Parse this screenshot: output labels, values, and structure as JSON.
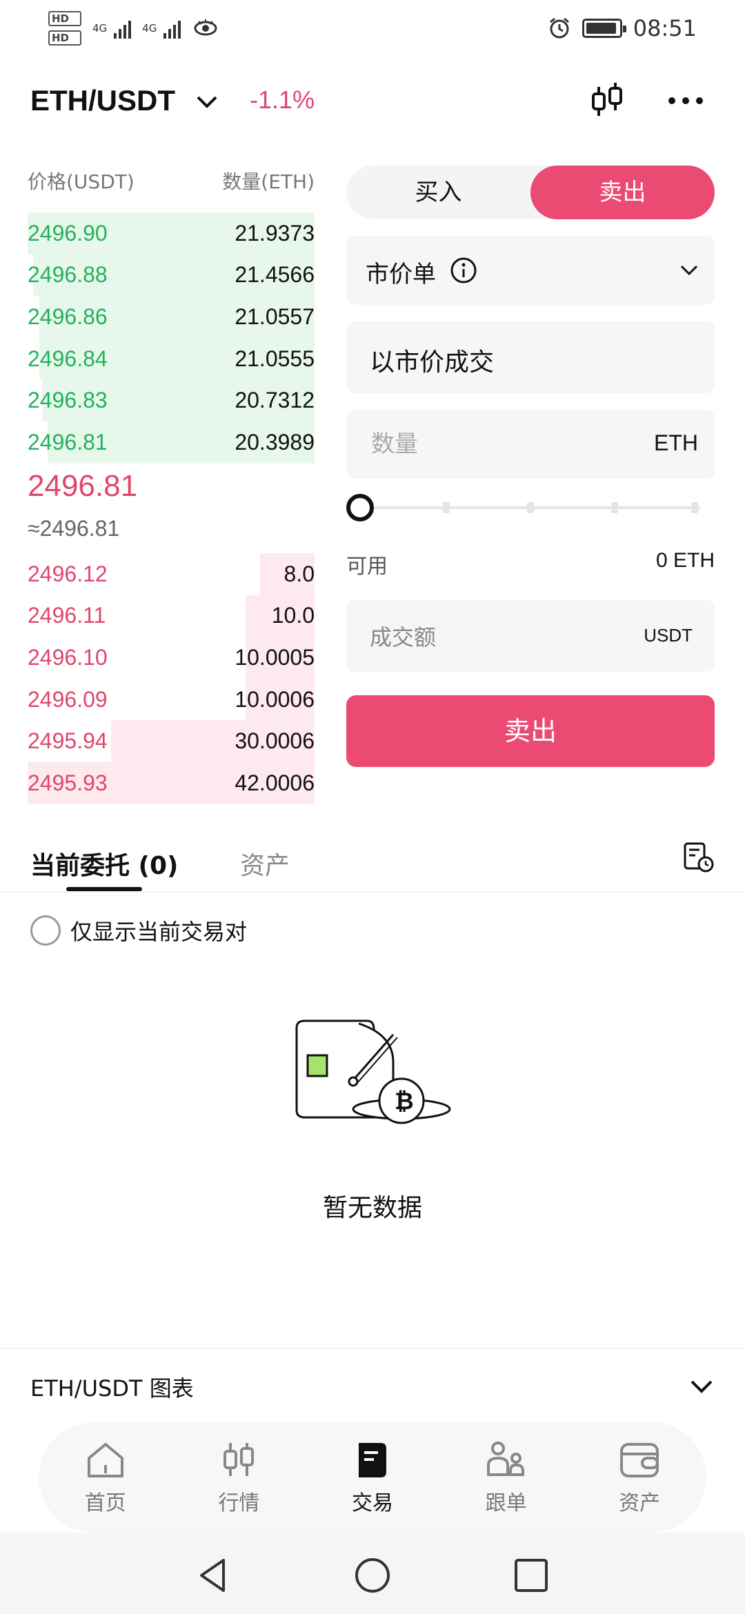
{
  "status_bar": {
    "time": "08:51",
    "network_1": "4G",
    "network_2": "4G",
    "hd1": "HD",
    "hd2": "HD"
  },
  "header": {
    "pair": "ETH/USDT",
    "change": "-1.1%"
  },
  "order_book": {
    "price_header": "价格(USDT)",
    "qty_header": "数量(ETH)",
    "asks": [
      {
        "price": "2496.90",
        "qty": "21.9373",
        "depth": 1.0
      },
      {
        "price": "2496.88",
        "qty": "21.4566",
        "depth": 0.98
      },
      {
        "price": "2496.86",
        "qty": "21.0557",
        "depth": 0.96
      },
      {
        "price": "2496.84",
        "qty": "21.0555",
        "depth": 0.96
      },
      {
        "price": "2496.83",
        "qty": "20.7312",
        "depth": 0.95
      },
      {
        "price": "2496.81",
        "qty": "20.3989",
        "depth": 0.93
      }
    ],
    "last_price": "2496.81",
    "last_price_approx": "≈2496.81",
    "bids": [
      {
        "price": "2496.12",
        "qty": "8.0",
        "depth": 0.19
      },
      {
        "price": "2496.11",
        "qty": "10.0",
        "depth": 0.24
      },
      {
        "price": "2496.10",
        "qty": "10.0005",
        "depth": 0.24
      },
      {
        "price": "2496.09",
        "qty": "10.0006",
        "depth": 0.24
      },
      {
        "price": "2495.94",
        "qty": "30.0006",
        "depth": 0.71
      },
      {
        "price": "2495.93",
        "qty": "42.0006",
        "depth": 1.0
      }
    ]
  },
  "trade": {
    "buy_label": "买入",
    "sell_label": "卖出",
    "order_type": "市价单",
    "market_text": "以市价成交",
    "qty_placeholder": "数量",
    "qty_unit": "ETH",
    "available_label": "可用",
    "available_value": "0 ETH",
    "amount_placeholder": "成交额",
    "amount_unit": "USDT",
    "submit_label": "卖出",
    "slider_value": 0
  },
  "tabs": {
    "orders": "当前委托 (0)",
    "assets": "资产"
  },
  "filter": {
    "label": "仅显示当前交易对"
  },
  "empty": {
    "text": "暂无数据"
  },
  "chart_bar": {
    "label": "ETH/USDT 图表"
  },
  "nav": [
    {
      "label": "首页",
      "icon": "home-icon"
    },
    {
      "label": "行情",
      "icon": "market-icon"
    },
    {
      "label": "交易",
      "icon": "trade-icon"
    },
    {
      "label": "跟单",
      "icon": "copy-trade-icon"
    },
    {
      "label": "资产",
      "icon": "wallet-icon"
    }
  ],
  "colors": {
    "accent": "#eb4a72",
    "green": "#20b35a",
    "red": "#e0466d"
  }
}
